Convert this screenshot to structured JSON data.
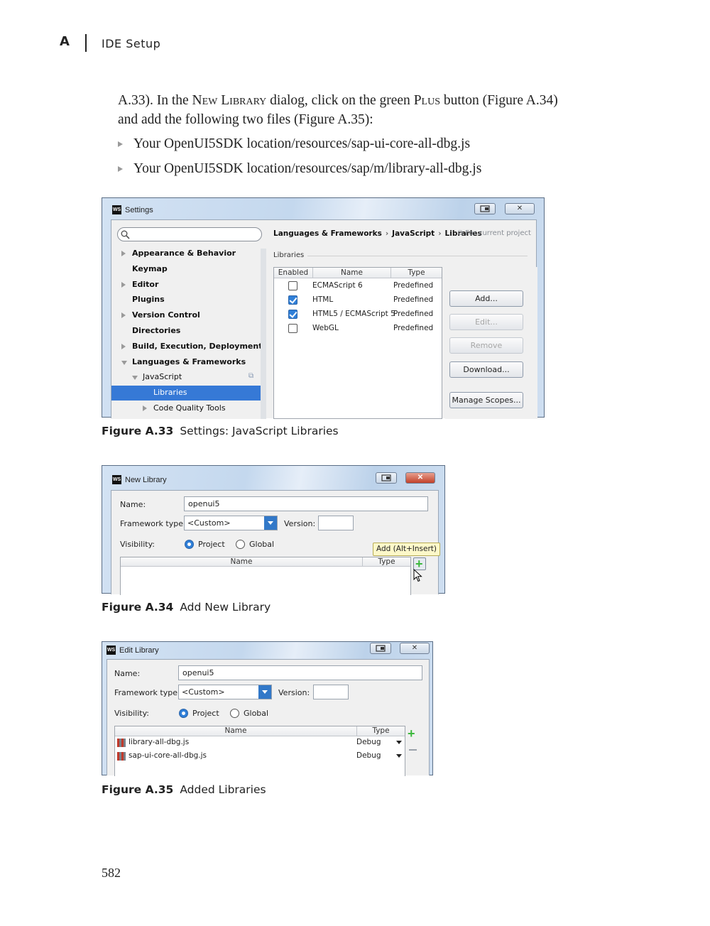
{
  "header": {
    "chapter_letter": "A",
    "chapter_title": "IDE Setup"
  },
  "body": {
    "paragraph": {
      "part1": "A.33). In the ",
      "new_library": "New Library",
      "part2": " dialog, click on the green ",
      "plus": "Plus",
      "part3": " button (Figure A.34)",
      "part4": "and add the following two files (Figure A.35):"
    },
    "bullets": [
      "Your OpenUI5SDK location/resources/sap-ui-core-all-dbg.js",
      "Your OpenUI5SDK location/resources/sap/m/library-all-dbg.js"
    ]
  },
  "fig33": {
    "window_title": "Settings",
    "logo": "WS",
    "restore_icon": "restore-icon",
    "close_icon": "close-icon",
    "search_icon": "search-icon",
    "tree": [
      {
        "label": "Appearance & Behavior",
        "arrow": "right"
      },
      {
        "label": "Keymap",
        "arrow": "none"
      },
      {
        "label": "Editor",
        "arrow": "right"
      },
      {
        "label": "Plugins",
        "arrow": "none"
      },
      {
        "label": "Version Control",
        "arrow": "right"
      },
      {
        "label": "Directories",
        "arrow": "none"
      },
      {
        "label": "Build, Execution, Deployment",
        "arrow": "right"
      },
      {
        "label": "Languages & Frameworks",
        "arrow": "down"
      },
      {
        "label": "JavaScript",
        "arrow": "down"
      },
      {
        "label": "Libraries",
        "arrow": "none",
        "selected": true
      },
      {
        "label": "Code Quality Tools",
        "arrow": "right"
      }
    ],
    "breadcrumb": [
      "Languages & Frameworks",
      "JavaScript",
      "Libraries"
    ],
    "scope_note": "For current project",
    "section_label": "Libraries",
    "columns": [
      "Enabled",
      "Name",
      "Type"
    ],
    "rows": [
      {
        "enabled": false,
        "name": "ECMAScript 6",
        "type": "Predefined"
      },
      {
        "enabled": true,
        "name": "HTML",
        "type": "Predefined"
      },
      {
        "enabled": true,
        "name": "HTML5 / ECMAScript 5",
        "type": "Predefined"
      },
      {
        "enabled": false,
        "name": "WebGL",
        "type": "Predefined"
      }
    ],
    "buttons": {
      "add": "Add...",
      "edit": "Edit...",
      "remove": "Remove",
      "download": "Download...",
      "manage": "Manage Scopes..."
    },
    "caption_num": "Figure A.33",
    "caption_text": "Settings: JavaScript Libraries"
  },
  "fig34": {
    "window_title": "New Library",
    "logo": "WS",
    "close_symbol": "x",
    "name_label": "Name:",
    "name_value": "openui5",
    "framework_label": "Framework type:",
    "framework_value": "<Custom>",
    "version_label": "Version:",
    "visibility_label": "Visibility:",
    "radio_project": "Project",
    "radio_global": "Global",
    "tooltip": "Add (Alt+Insert)",
    "columns": [
      "Name",
      "Type"
    ],
    "add_icon": "plus-icon",
    "caption_num": "Figure A.34",
    "caption_text": "Add New Library"
  },
  "fig35": {
    "window_title": "Edit Library",
    "logo": "WS",
    "close_symbol": "x",
    "name_label": "Name:",
    "name_value": "openui5",
    "framework_label": "Framework type:",
    "framework_value": "<Custom>",
    "version_label": "Version:",
    "visibility_label": "Visibility:",
    "radio_project": "Project",
    "radio_global": "Global",
    "columns": [
      "Name",
      "Type"
    ],
    "rows": [
      {
        "name": "library-all-dbg.js",
        "type": "Debug"
      },
      {
        "name": "sap-ui-core-all-dbg.js",
        "type": "Debug"
      }
    ],
    "add_icon": "plus-icon",
    "remove_icon": "minus-icon",
    "caption_num": "Figure A.35",
    "caption_text": "Added Libraries"
  },
  "footer": {
    "page_number": "582"
  }
}
